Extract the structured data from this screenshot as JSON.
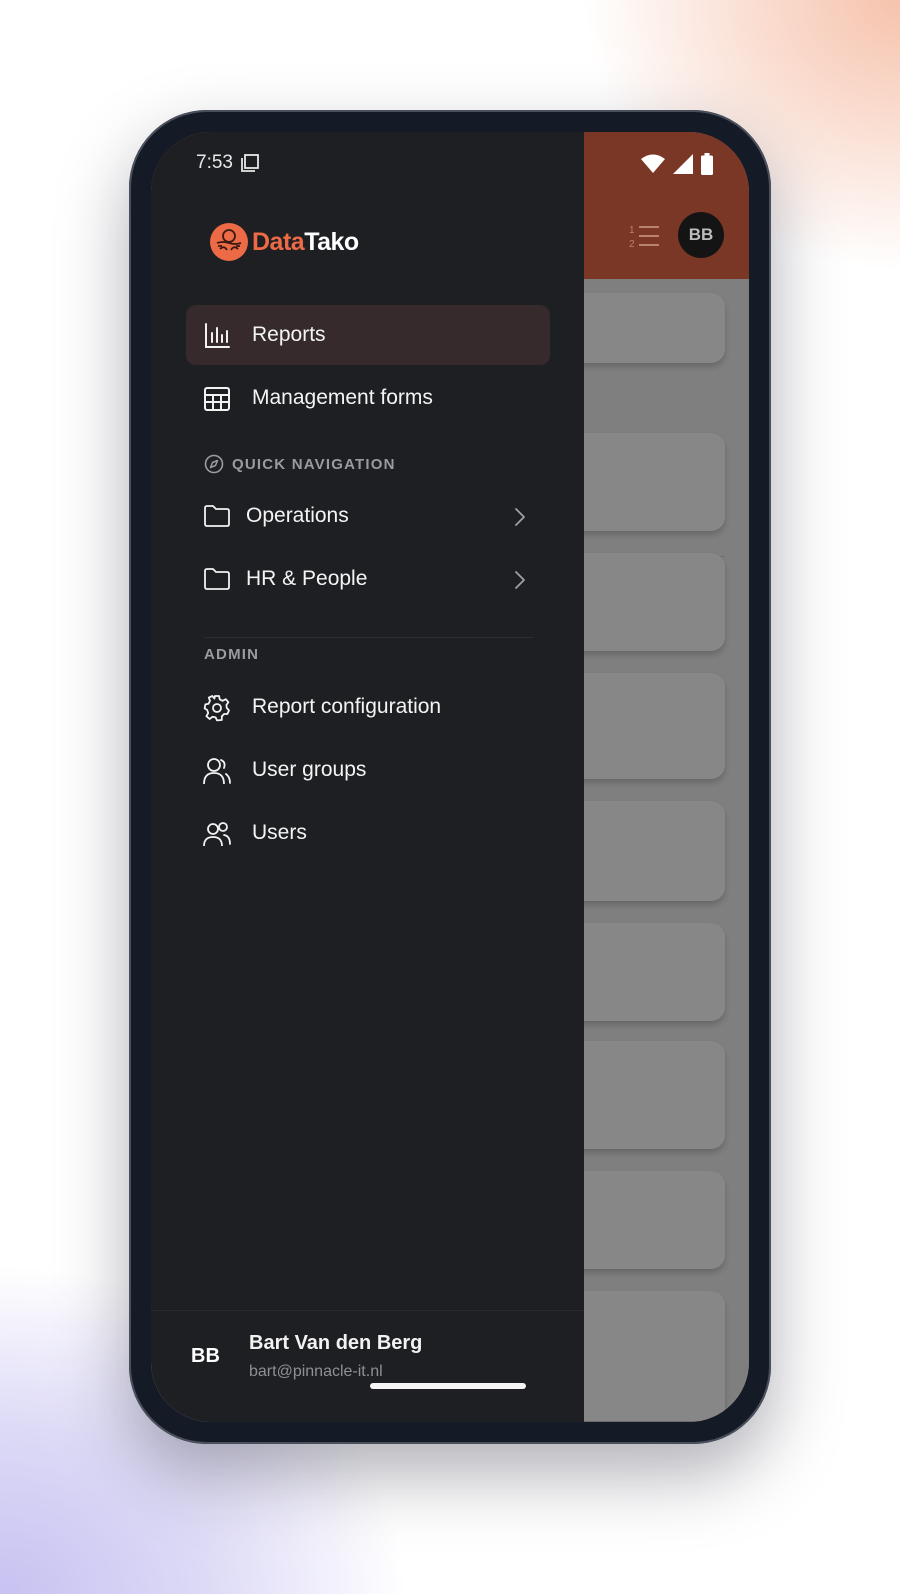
{
  "status_bar": {
    "time": "7:53"
  },
  "app": {
    "header_avatar": "BB"
  },
  "drawer": {
    "brand": {
      "part1": "Data",
      "part2": "Tako"
    },
    "main_items": [
      {
        "label": "Reports",
        "icon": "bar-chart-icon",
        "active": true
      },
      {
        "label": "Management forms",
        "icon": "table-icon",
        "active": false
      }
    ],
    "quick_nav": {
      "label": "QUICK NAVIGATION",
      "items": [
        {
          "label": "Operations",
          "icon": "folder-icon"
        },
        {
          "label": "HR & People",
          "icon": "folder-icon"
        }
      ]
    },
    "admin": {
      "label": "ADMIN",
      "items": [
        {
          "label": "Report configuration",
          "icon": "gear-icon"
        },
        {
          "label": "User groups",
          "icon": "user-icon"
        },
        {
          "label": "Users",
          "icon": "users-icon"
        }
      ]
    },
    "user": {
      "initials": "BB",
      "name": "Bart Van den Berg",
      "email": "bart@pinnacle-it.nl"
    }
  },
  "colors": {
    "accent": "#ec6a45",
    "header_dimmed": "#7b3726",
    "drawer_bg": "#1e1f23",
    "active_item_bg": "#362a2c"
  }
}
